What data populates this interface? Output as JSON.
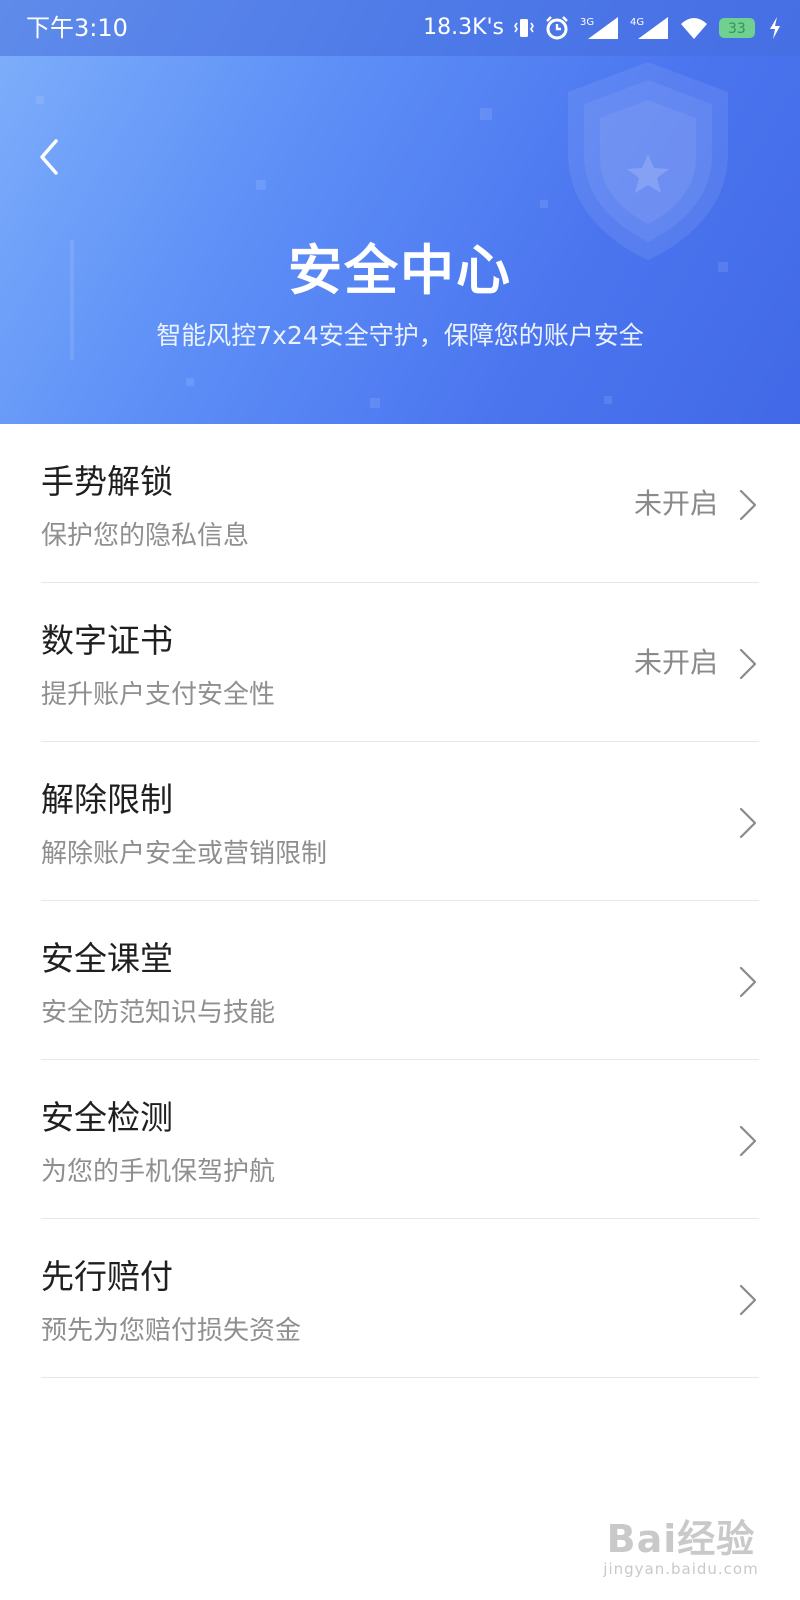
{
  "status_bar": {
    "time": "下午3:10",
    "network_speed": "18.3K's",
    "sim1_label": "3G",
    "sim2_label": "4G",
    "battery_level": "33"
  },
  "header": {
    "title": "安全中心",
    "subtitle": "智能风控7x24安全守护，保障您的账户安全"
  },
  "menu": {
    "items": [
      {
        "title": "手势解锁",
        "subtitle": "保护您的隐私信息",
        "status": "未开启"
      },
      {
        "title": "数字证书",
        "subtitle": "提升账户支付安全性",
        "status": "未开启"
      },
      {
        "title": "解除限制",
        "subtitle": "解除账户安全或营销限制",
        "status": ""
      },
      {
        "title": "安全课堂",
        "subtitle": "安全防范知识与技能",
        "status": ""
      },
      {
        "title": "安全检测",
        "subtitle": "为您的手机保驾护航",
        "status": ""
      },
      {
        "title": "先行赔付",
        "subtitle": "预先为您赔付损失资金",
        "status": ""
      }
    ]
  },
  "watermark": {
    "logo_text": "Bai经验",
    "url": "jingyan.baidu.com"
  },
  "icons": {
    "back": "back-arrow-icon",
    "chevron": "chevron-right-icon",
    "shield": "shield-star-icon"
  },
  "colors": {
    "header_gradient_start": "#7fb0fb",
    "header_gradient_end": "#4169e7",
    "title_text": "#1f1f1f",
    "subtitle_text": "#8f8f8f",
    "battery": "#6fd08f"
  }
}
